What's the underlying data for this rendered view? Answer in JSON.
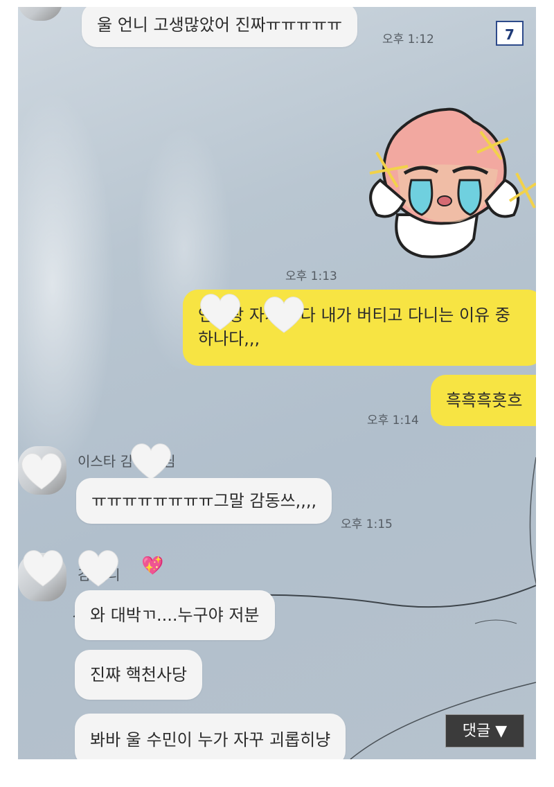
{
  "page_badge": "7",
  "comments_button": "댓글 ▼",
  "messages": {
    "m1": {
      "text": "울 언니 고생많았어 진짜ㅠㅠㅠㅠㅠ",
      "time": "오후 1:12"
    },
    "sticker_time": "오후 1:13",
    "m2": {
      "line1": "언니랑 자기도 다 내가 버티고 다니는 이유 중",
      "line2": "하나다,,,"
    },
    "m3": {
      "text": "흑흑흑흣흐",
      "time": "오후 1:14"
    },
    "m4": {
      "sender": "이스타 김  선배님",
      "text": "ㅠㅠㅠㅠㅠㅠㅠㅠ그말 감동쓰,,,,",
      "time": "오후 1:15"
    },
    "m5": {
      "sender": "김  언니",
      "text": "와 대박ㄲ....누구야 저분"
    },
    "m6": {
      "text": "진쨔 핵천사당"
    },
    "m7": {
      "text": "봐바 울 수민이 누가 자꾸 괴롭히냥"
    }
  },
  "sticker_icon": "crying-peach-character-icon",
  "colors": {
    "yellow_bubble": "#f7e443",
    "white_bubble": "#f4f4f4",
    "badge_border": "#2d4a8a"
  }
}
